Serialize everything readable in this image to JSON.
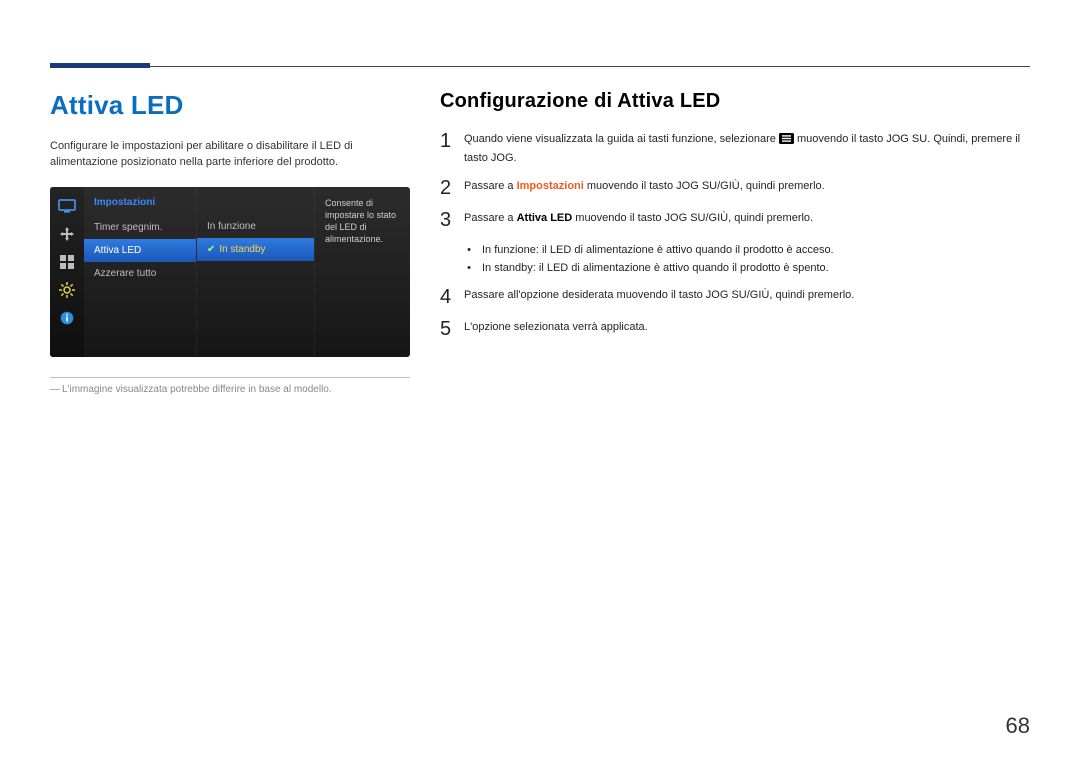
{
  "page_number": "68",
  "left": {
    "heading": "Attiva LED",
    "intro": "Configurare le impostazioni per abilitare o disabilitare il LED di alimentazione posizionato nella parte inferiore del prodotto.",
    "footnote": "L'immagine visualizzata potrebbe differire in base al modello."
  },
  "osd": {
    "title": "Impostazioni",
    "items": [
      "Timer spegnim.",
      "Attiva LED",
      "Azzerare tutto"
    ],
    "selected_index": 1,
    "options": [
      "In funzione",
      "In standby"
    ],
    "selected_option_index": 1,
    "description": "Consente di impostare lo stato del LED di alimentazione."
  },
  "right": {
    "heading": "Configurazione di Attiva LED",
    "step1_a": "Quando viene visualizzata la guida ai tasti funzione, selezionare ",
    "step1_b": " muovendo il tasto JOG SU. Quindi, premere il tasto JOG.",
    "step2_a": "Passare a ",
    "step2_bold": "Impostazioni",
    "step2_b": " muovendo il tasto JOG SU/GIÙ, quindi premerlo.",
    "step3_a": "Passare a ",
    "step3_bold": "Attiva LED",
    "step3_b": " muovendo il tasto JOG SU/GIÙ, quindi premerlo.",
    "bullet1_label": "In funzione",
    "bullet1_text": ": il LED di alimentazione è attivo quando il prodotto è acceso.",
    "bullet2_label": "In standby",
    "bullet2_text": ": il LED di alimentazione è attivo quando il prodotto è spento.",
    "step4": "Passare all'opzione desiderata muovendo il tasto JOG SU/GIÙ, quindi premerlo.",
    "step5": "L'opzione selezionata verrà applicata."
  }
}
